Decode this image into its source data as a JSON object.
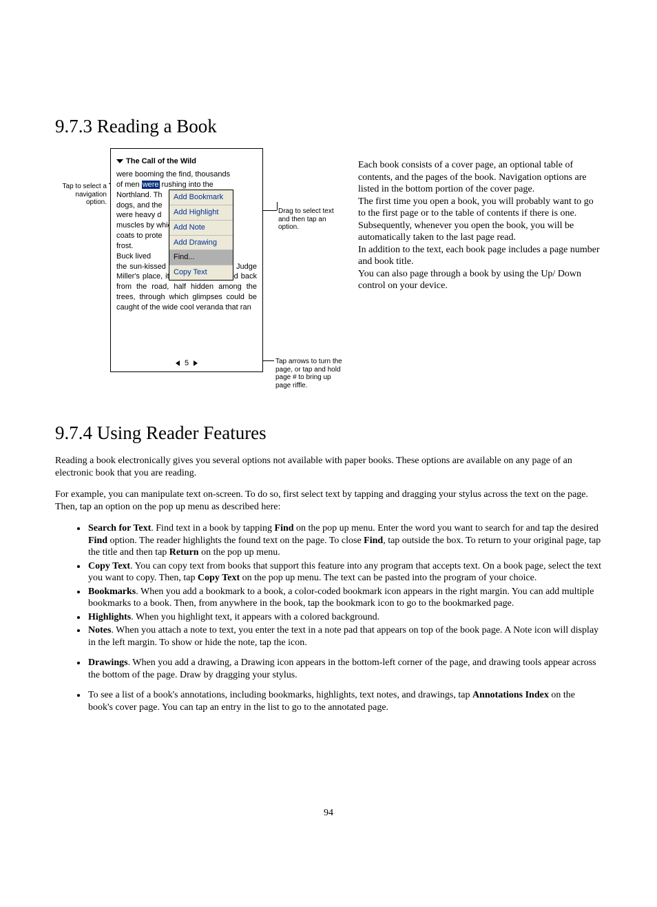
{
  "page_number": "94",
  "section_973": {
    "heading": "9.7.3 Reading a Book",
    "paragraphs": [
      "Each book consists of a cover page, an optional table of contents, and the pages of the book. Navigation options are listed in the bottom portion of the cover page.",
      "The first time you open a book, you will probably want to go to the first page or to the table of contents if there is one.",
      "Subsequently, whenever you open the book, you will be automatically taken to the last page read.",
      "In addition to the text, each book page includes a page number and book title.",
      "You can also page through a book by using the Up/ Down control on your device."
    ],
    "figure": {
      "annot_left": "Tap to select a navigation option.",
      "annot_right1": "Drag to select text and then tap an option.",
      "annot_right2": "Tap arrows to turn the page, or tap and hold page # to bring up page riffle.",
      "book_title": "The Call of the Wild",
      "line1": "were booming the find, thousands",
      "line2a": "of men ",
      "line2_hl": "were",
      "line2b": " rushing into the",
      "line3": "Northland. Th",
      "line4": "dogs, and the",
      "line5": "were heavy d",
      "line6": "muscles by whic",
      "line7": "coats to prote",
      "line8": "frost.",
      "line9": "    Buck lived",
      "rest": "the sun-kissed Santa Clara Valley. Judge Miller's place, it was called. It stood back from the road, half hidden among the trees, through which glimpses could be caught of the wide cool veranda that ran",
      "popup": {
        "items": [
          "Add Bookmark",
          "Add Highlight",
          "Add Note",
          "Add Drawing",
          "Find...",
          "Copy Text"
        ],
        "selected_index": 4
      },
      "page_indicator": "5"
    }
  },
  "section_974": {
    "heading": "9.7.4 Using Reader Features",
    "intro1": "Reading a book electronically gives you several options not available with paper books. These options are available on any page of an electronic book that you are reading.",
    "intro2": "For example, you can manipulate text on-screen.  To do so, first select text by tapping and dragging your stylus across the text on the page. Then, tap an option on the pop up menu as described here:",
    "features": [
      {
        "bold": "Search for Text",
        "rest": ". Find text in a book by tapping ",
        "b2": "Find",
        "rest2": " on the pop up menu. Enter the word you want to search for and tap the desired ",
        "b3": "Find",
        "rest3": " option. The reader highlights the found text on the page. To close ",
        "b4": "Find",
        "rest4": ", tap outside the box. To return to your original page, tap the title and then tap ",
        "b5": "Return",
        "rest5": " on the pop up menu."
      },
      {
        "bold": "Copy Text",
        "rest": ". You can copy text from books that support this feature into any program that accepts text. On a book page, select the text you want to copy. Then, tap ",
        "b2": "Copy Text",
        "rest2": " on the pop up menu. The text can be pasted into the program of your choice."
      },
      {
        "bold": "Bookmarks",
        "rest": ". When you add a bookmark to a book, a color-coded bookmark icon appears in the right margin. You can add multiple bookmarks to a book. Then, from anywhere in the book, tap the bookmark icon to go to the bookmarked page."
      },
      {
        "bold": "Highlights",
        "rest": ". When you highlight text, it appears with a colored background."
      },
      {
        "bold": "Notes",
        "rest": ". When you attach a note to text, you enter the text in a note pad that appears on top of the book page. A Note icon will display in the left margin. To show or hide the note, tap the icon."
      },
      {
        "bold": "Drawings",
        "rest": ". When you add a drawing, a Drawing icon appears in the bottom-left corner of the page, and drawing tools appear across the bottom of the page. Draw by dragging your stylus."
      }
    ],
    "final": {
      "pre": "To see a list of a book's annotations, including bookmarks, highlights, text notes, and drawings, tap ",
      "b": "Annotations Index",
      "post": " on the book's cover page. You can tap an entry in the list to go to the annotated page."
    }
  }
}
